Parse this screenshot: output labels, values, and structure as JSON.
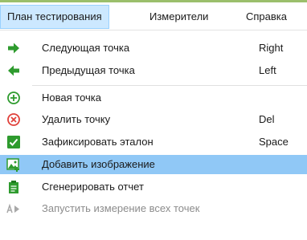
{
  "menubar": {
    "items": [
      {
        "label": "План тестирования",
        "active": true
      },
      {
        "label": "Измерители",
        "active": false
      },
      {
        "label": "Справка",
        "active": false
      }
    ]
  },
  "menu": {
    "items": [
      {
        "icon": "arrow-right-icon",
        "label": "Следующая точка",
        "shortcut": "Right"
      },
      {
        "icon": "arrow-left-icon",
        "label": "Предыдущая точка",
        "shortcut": "Left"
      },
      {
        "icon": "add-point-icon",
        "label": "Новая точка",
        "shortcut": ""
      },
      {
        "icon": "delete-point-icon",
        "label": "Удалить точку",
        "shortcut": "Del"
      },
      {
        "icon": "checkbox-checked-icon",
        "label": "Зафиксировать эталон",
        "shortcut": "Space"
      },
      {
        "icon": "add-image-icon",
        "label": "Добавить изображение",
        "shortcut": "",
        "highlighted": true
      },
      {
        "icon": "clipboard-report-icon",
        "label": "Сгенерировать отчет",
        "shortcut": ""
      },
      {
        "icon": "run-all-icon",
        "label": "Запустить измерение всех точек",
        "shortcut": "",
        "disabled": true
      }
    ]
  },
  "colors": {
    "accent_green": "#2e9b2e",
    "highlight": "#90c8f6",
    "active_menu": "#cce8ff",
    "delete_red": "#e0413b",
    "disabled_text": "#8c8c8c"
  }
}
